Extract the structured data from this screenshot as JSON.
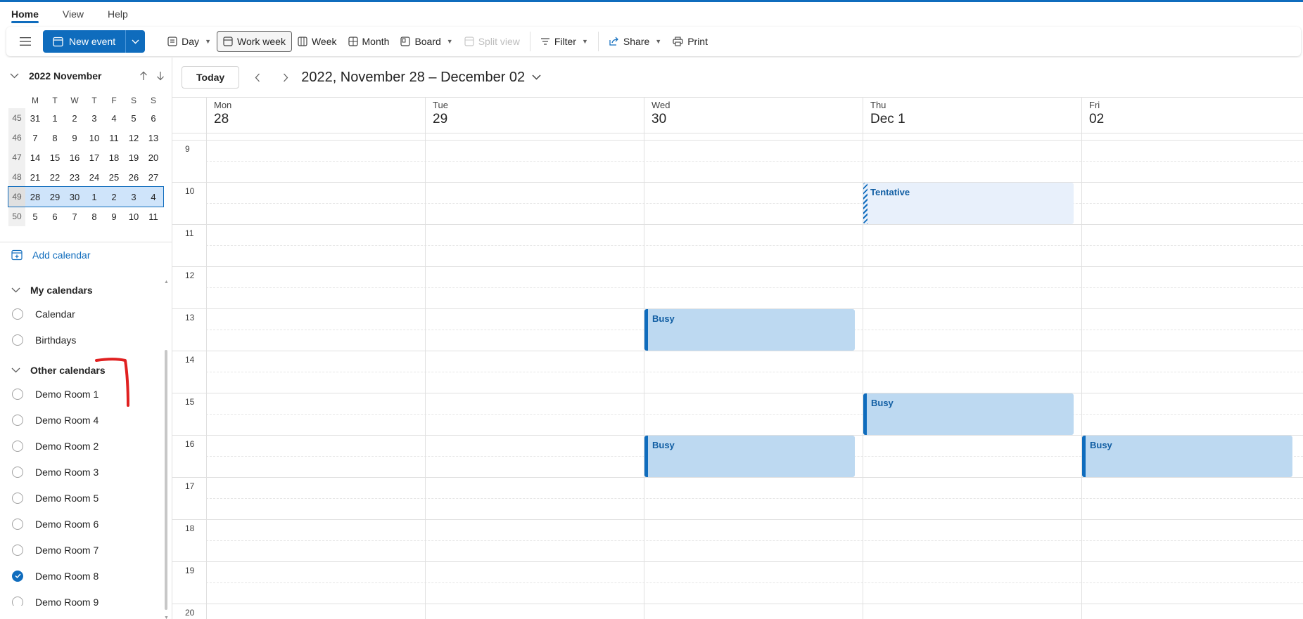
{
  "ribbon": {
    "tabs": [
      {
        "label": "Home"
      },
      {
        "label": "View"
      },
      {
        "label": "Help"
      }
    ]
  },
  "toolbar": {
    "new_event": "New event",
    "day": "Day",
    "work_week": "Work week",
    "week": "Week",
    "month": "Month",
    "board": "Board",
    "split_view": "Split view",
    "filter": "Filter",
    "share": "Share",
    "print": "Print"
  },
  "mini_calendar": {
    "title": "2022 November",
    "weekday_headers": [
      "M",
      "T",
      "W",
      "T",
      "F",
      "S",
      "S"
    ],
    "weeks": [
      {
        "num": "45",
        "days": [
          "31",
          "1",
          "2",
          "3",
          "4",
          "5",
          "6"
        ]
      },
      {
        "num": "46",
        "days": [
          "7",
          "8",
          "9",
          "10",
          "11",
          "12",
          "13"
        ]
      },
      {
        "num": "47",
        "days": [
          "14",
          "15",
          "16",
          "17",
          "18",
          "19",
          "20"
        ]
      },
      {
        "num": "48",
        "days": [
          "21",
          "22",
          "23",
          "24",
          "25",
          "26",
          "27"
        ]
      },
      {
        "num": "49",
        "days": [
          "28",
          "29",
          "30",
          "1",
          "2",
          "3",
          "4"
        ],
        "selected": true
      },
      {
        "num": "50",
        "days": [
          "5",
          "6",
          "7",
          "8",
          "9",
          "10",
          "11"
        ]
      }
    ]
  },
  "add_calendar": "Add calendar",
  "my_calendars": {
    "title": "My calendars",
    "items": [
      "Calendar",
      "Birthdays"
    ]
  },
  "other_calendars": {
    "title": "Other calendars",
    "items": [
      "Demo Room 1",
      "Demo Room 4",
      "Demo Room 2",
      "Demo Room 3",
      "Demo Room 5",
      "Demo Room 6",
      "Demo Room 7",
      "Demo Room 8",
      "Demo Room 9"
    ],
    "checked": "Demo Room 8"
  },
  "main": {
    "today": "Today",
    "range_title": "2022, November 28 – December 02",
    "days": [
      {
        "name": "Mon",
        "date": "28"
      },
      {
        "name": "Tue",
        "date": "29"
      },
      {
        "name": "Wed",
        "date": "30"
      },
      {
        "name": "Thu",
        "date": "Dec 1"
      },
      {
        "name": "Fri",
        "date": "02"
      }
    ],
    "hours": [
      "9",
      "10",
      "11",
      "12",
      "13",
      "14",
      "15",
      "16",
      "17",
      "18",
      "19",
      "20"
    ],
    "events": [
      {
        "day": 3,
        "start": 10,
        "end": 11,
        "label": "Tentative",
        "status": "tentative"
      },
      {
        "day": 2,
        "start": 13,
        "end": 14,
        "label": "Busy",
        "status": "busy"
      },
      {
        "day": 3,
        "start": 15,
        "end": 16,
        "label": "Busy",
        "status": "busy"
      },
      {
        "day": 2,
        "start": 16,
        "end": 17,
        "label": "Busy",
        "status": "busy"
      },
      {
        "day": 4,
        "start": 16,
        "end": 17,
        "label": "Busy",
        "status": "busy"
      }
    ]
  },
  "colors": {
    "accent": "#0f6cbd",
    "busy_fill": "#bdd9f1",
    "tentative_fill": "#e8f0fb",
    "annotation": "#e02020"
  }
}
